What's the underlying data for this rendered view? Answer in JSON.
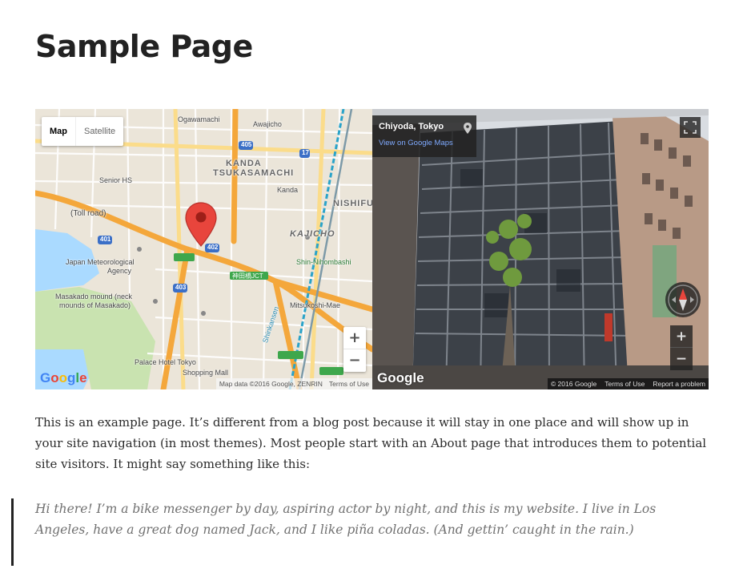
{
  "page": {
    "title": "Sample Page"
  },
  "map": {
    "type_control": {
      "map_label": "Map",
      "satellite_label": "Satellite",
      "selected": "Map"
    },
    "labels": {
      "ogawamachi": "Ogawamachi",
      "awajicho": "Awajicho",
      "kanda_tsukasamachi_1": "KANDA",
      "kanda_tsukasamachi_2": "TSUKASAMACHI",
      "kanda": "Kanda",
      "senior_hs": "Senior HS",
      "nishifuku": "NISHIFU",
      "toll_road": "(Toll road)",
      "kajicho": "KAJICHO",
      "meteorological_1": "Japan Meteorological",
      "meteorological_2": "Agency",
      "shin_nihombashi": "Shin-Nihombashi",
      "masakado_1": "Masakado mound (neck",
      "masakado_2": "mounds of Masakado)",
      "mitsukoshi": "Mitsukoshi-Mae",
      "palace_hotel": "Palace Hotel Tokyo",
      "shopping_mall": "Shopping Mall",
      "shinkansen": "Shinkansen",
      "jct": "神田橋JCT",
      "route_405": "405",
      "route_401": "401",
      "route_402": "402",
      "route_403": "403",
      "route_17": "17"
    },
    "zoom": {
      "in": "+",
      "out": "−"
    },
    "logo": {
      "g": "G",
      "o1": "o",
      "o2": "o",
      "g2": "g",
      "l": "l",
      "e": "e"
    },
    "attribution": {
      "data": "Map data ©2016 Google, ZENRIN",
      "terms": "Terms of Use"
    },
    "colors": {
      "pin": "#e8453c",
      "highway": "#f4a73b",
      "water": "#aadaff",
      "park": "#c9e3b0"
    }
  },
  "street_view": {
    "location": "Chiyoda, Tokyo",
    "link": "View on Google Maps",
    "zoom": {
      "in": "+",
      "out": "−"
    },
    "logo": "Google",
    "attribution": {
      "copyright": "© 2016 Google",
      "terms": "Terms of Use",
      "report": "Report a problem"
    },
    "icons": {
      "pin": "map-pin-icon",
      "fullscreen": "fullscreen-icon",
      "compass": "compass-icon"
    }
  },
  "content": {
    "paragraph": "This is an example page. It’s different from a blog post because it will stay in one place and will show up in your site navigation (in most themes). Most people start with an About page that introduces them to potential site visitors. It might say something like this:",
    "quote": "Hi there! I’m a bike messenger by day, aspiring actor by night, and this is my website. I live in Los Angeles, have a great dog named Jack, and I like piña coladas. (And gettin’ caught in the rain.)"
  }
}
